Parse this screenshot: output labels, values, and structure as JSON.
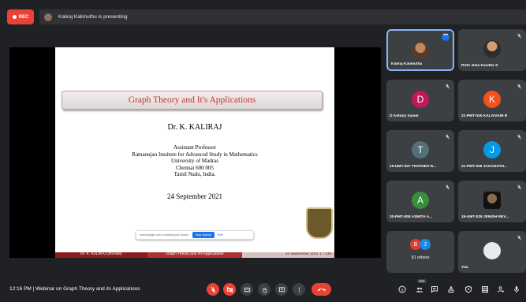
{
  "recording": {
    "label": "REC"
  },
  "presenter": {
    "text": "Kaliraj Kalimuthu is presenting"
  },
  "slide": {
    "title": "Graph Theory and It's Applications",
    "author": "Dr. K. KALIRAJ",
    "affiliation": [
      "Assistant Professor",
      "Ramanujan Institute for Advanced Study in Mathematics",
      "University of Madras",
      "Chennai 600 005",
      "Tamil Nadu, India."
    ],
    "date": "24 September 2021",
    "footer": {
      "left": "Dr. K. KALIRAJ (RIASM)",
      "center": "Graph Theory and It's Applications",
      "right": "24 September 2021    1 / 136"
    },
    "share_banner": {
      "text": "meet.google.com is sharing your screen.",
      "stop_label": "Stop sharing",
      "hide_label": "Hide"
    }
  },
  "participants": [
    {
      "name": "Kaliraj Kalimuthu",
      "avatar_type": "photo",
      "initial": "",
      "color": ""
    },
    {
      "name": "Ruth Julia Kavitha S",
      "avatar_type": "photo",
      "initial": "",
      "color": ""
    },
    {
      "name": "D Antony Xavier",
      "avatar_type": "letter",
      "initial": "D",
      "color": "#c2185b"
    },
    {
      "name": "21-PMT-030 KALAIVANI R",
      "avatar_type": "letter",
      "initial": "K",
      "color": "#f4511e"
    },
    {
      "name": "19-UMT-307 THATHES R...",
      "avatar_type": "letter",
      "initial": "T",
      "color": "#546e7a"
    },
    {
      "name": "21-PMT-036 JAGANATH...",
      "avatar_type": "letter",
      "initial": "J",
      "color": "#039be5"
    },
    {
      "name": "20-PMT-008 ASMITA A...",
      "avatar_type": "letter",
      "initial": "A",
      "color": "#388e3c"
    },
    {
      "name": "19-UMT-029 JENISH REV...",
      "avatar_type": "photo",
      "initial": "",
      "color": ""
    },
    {
      "name": "91 others",
      "avatar_type": "group",
      "initial": "",
      "color": ""
    },
    {
      "name": "You",
      "avatar_type": "photo",
      "initial": "",
      "color": ""
    }
  ],
  "others_tile": {
    "label": "91 others",
    "initials": [
      "B",
      "J"
    ],
    "colors": [
      "#e53935",
      "#1e88e5"
    ]
  },
  "bottom_bar": {
    "time": "12:16 PM",
    "separator": "|",
    "meeting_title": "Webinar on Graph Theory and its Applications",
    "participant_count": "101"
  },
  "colors": {
    "background": "#202124",
    "tile": "#3c4043",
    "accent_red": "#ea4335",
    "accent_blue": "#1a73e8"
  }
}
